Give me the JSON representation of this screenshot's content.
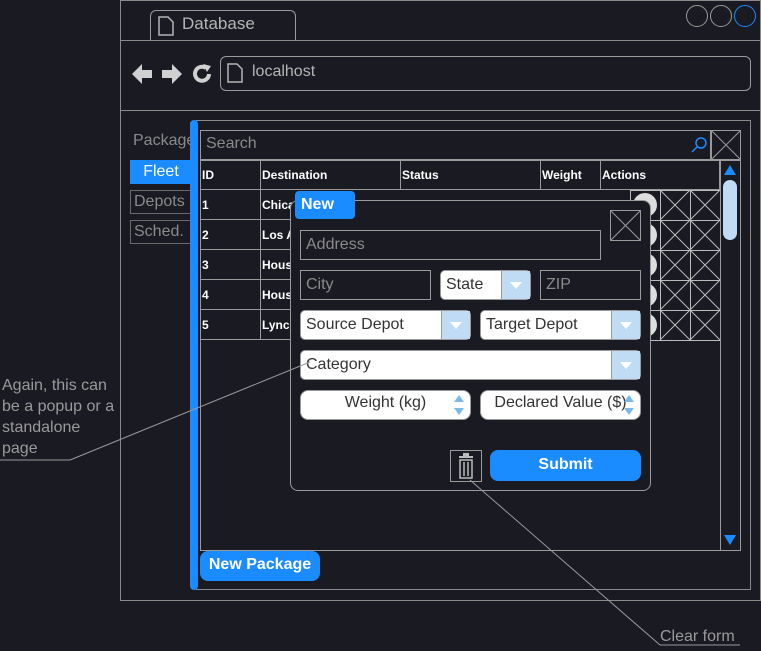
{
  "browser": {
    "tab_title": "Database",
    "address": "localhost"
  },
  "sidebar": {
    "items": [
      {
        "label": "Package"
      },
      {
        "label": "Fleet"
      },
      {
        "label": "Depots"
      },
      {
        "label": "Sched."
      }
    ]
  },
  "search": {
    "placeholder": "Search"
  },
  "table": {
    "headers": [
      "ID",
      "Destination",
      "Status",
      "Weight",
      "Actions"
    ],
    "rows": [
      {
        "id": "1",
        "destination": "Chica"
      },
      {
        "id": "2",
        "destination": "Los A"
      },
      {
        "id": "3",
        "destination": "Hous"
      },
      {
        "id": "4",
        "destination": "Hous"
      },
      {
        "id": "5",
        "destination": "Lynch"
      }
    ]
  },
  "new_package_label": "New Package",
  "popup": {
    "title": "New",
    "address": "Address",
    "city": "City",
    "state": "State",
    "zip": "ZIP",
    "source_depot": "Source Depot",
    "target_depot": "Target Depot",
    "category": "Category",
    "weight": "Weight (kg)",
    "declared_value": "Declared Value ($)",
    "submit": "Submit"
  },
  "annotations": {
    "popup_note": "Again, this can be a popup or a standalone page",
    "clear_form": "Clear form"
  },
  "colors": {
    "accent": "#1a8cff",
    "background": "#1a1a22"
  }
}
